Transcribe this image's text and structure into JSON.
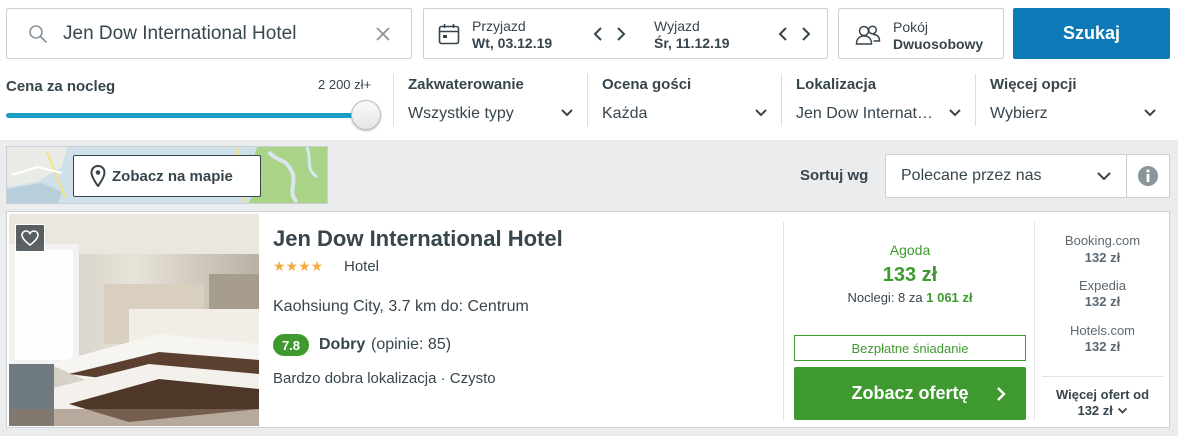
{
  "search": {
    "value": "Jen Dow International Hotel"
  },
  "dates": {
    "checkin_label": "Przyjazd",
    "checkin_value": "Wt, 03.12.19",
    "checkout_label": "Wyjazd",
    "checkout_value": "Śr, 11.12.19"
  },
  "rooms": {
    "label": "Pokój",
    "value": "Dwuosobowy"
  },
  "search_button": "Szukaj",
  "filters": {
    "price": {
      "label": "Cena za nocleg",
      "max": "2 200 zł+",
      "level": 1.0
    },
    "accommodation": {
      "label": "Zakwaterowanie",
      "value": "Wszystkie typy"
    },
    "rating": {
      "label": "Ocena gości",
      "value": "Każda"
    },
    "location": {
      "label": "Lokalizacja",
      "value": "Jen Dow Internat…"
    },
    "more": {
      "label": "Więcej opcji",
      "value": "Wybierz"
    }
  },
  "map": {
    "button": "Zobacz na mapie"
  },
  "sort": {
    "label": "Sortuj wg",
    "value": "Polecane przez nas"
  },
  "hotel": {
    "name": "Jen Dow International Hotel",
    "stars": "★★★★",
    "type": "Hotel",
    "location": "Kaohsiung City, 3.7 km do: Centrum",
    "rating_score": "7.8",
    "rating_word": "Dobry",
    "rating_count": "(opinie: 85)",
    "features": "Bardzo dobra lokalizacja · Czysto"
  },
  "deal": {
    "provider": "Agoda",
    "price": "133 zł",
    "nights_text": "Noclegi: 8 za",
    "nights_total": "1 061 zł",
    "breakfast": "Bezpłatne śniadanie",
    "button": "Zobacz ofertę"
  },
  "other_offers": [
    {
      "provider": "Booking.com",
      "price": "132 zł"
    },
    {
      "provider": "Expedia",
      "price": "132 zł"
    },
    {
      "provider": "Hotels.com",
      "price": "132 zł"
    }
  ],
  "more_offers": {
    "line1": "Więcej ofert od",
    "line2": "132 zł"
  },
  "colors": {
    "accent": "#0d79b6",
    "deal_green": "#3e9a2f",
    "star": "#f6ab3f",
    "slider": "#1a9fc4"
  }
}
